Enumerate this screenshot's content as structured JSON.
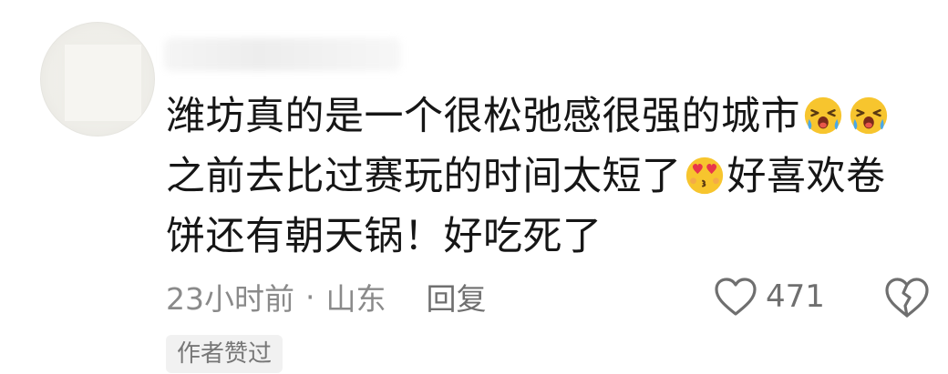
{
  "comment": {
    "line1": "潍坊真的是一个很松弛感很强的城市",
    "line2_a": "之前去比过赛玩的时间太短了",
    "line2_b": "好喜欢卷",
    "line3": "饼还有朝天锅！好吃死了",
    "emojis": [
      "crying-face-icon",
      "crying-face-icon",
      "heart-eyes-face-icon"
    ]
  },
  "meta": {
    "time": "23小时前",
    "separator": "·",
    "location": "山东",
    "reply_label": "回复"
  },
  "actions": {
    "like_count": "471"
  },
  "badge": {
    "label": "作者赞过"
  },
  "colors": {
    "text": "#161616",
    "meta": "#8a8a8a",
    "icon": "#6f6f6f",
    "badge_bg": "#f1f1f1",
    "emoji_yellow": "#f7c52e",
    "emoji_heart": "#e8364a"
  }
}
